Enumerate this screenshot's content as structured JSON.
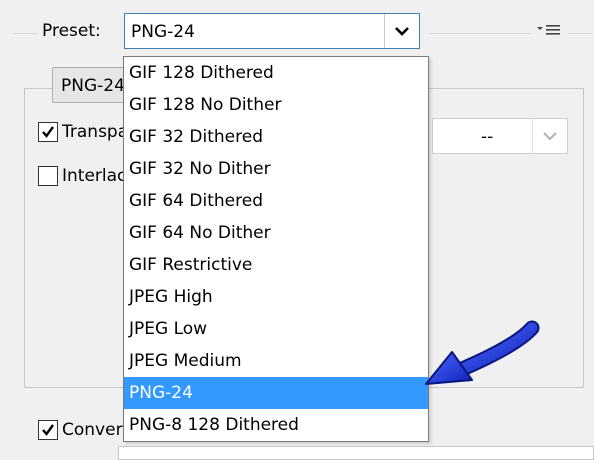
{
  "preset": {
    "label": "Preset:",
    "value": "PNG-24",
    "options": [
      "GIF 128 Dithered",
      "GIF 128 No Dither",
      "GIF 32 Dithered",
      "GIF 32 No Dither",
      "GIF 64 Dithered",
      "GIF 64 No Dither",
      "GIF Restrictive",
      "JPEG High",
      "JPEG Low",
      "JPEG Medium",
      "PNG-24",
      "PNG-8 128 Dithered"
    ],
    "selected_option": "PNG-24"
  },
  "format": {
    "value": "PNG-24"
  },
  "options": {
    "transparency": {
      "label": "Transparency",
      "checked": true
    },
    "interlaced": {
      "label": "Interlaced",
      "checked": false
    },
    "convert": {
      "label": "Convert to sRGB",
      "checked": true
    }
  },
  "matte": {
    "value": "--"
  },
  "colors": {
    "selection": "#3399ff",
    "arrow": "#1a2fd6",
    "focus_border": "#3c7fb1"
  },
  "icons": {
    "menu": "flyout-menu-icon",
    "dropdown": "chevron-down-icon",
    "check": "checkmark-icon",
    "annotation": "blue-arrow-icon"
  }
}
